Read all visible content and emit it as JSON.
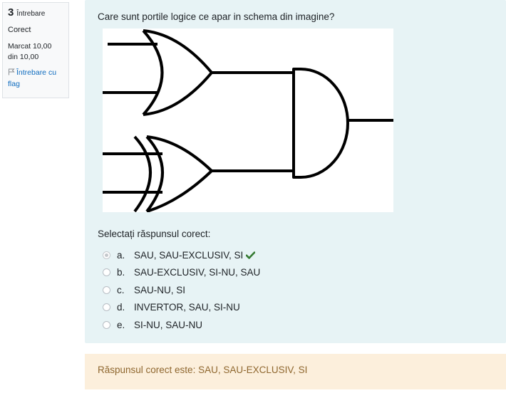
{
  "info": {
    "question_number": "3",
    "question_label": "Întrebare",
    "state": "Corect",
    "grade_line1": "Marcat 10,00",
    "grade_line2": "din 10,00",
    "flag_label": "Întrebare cu flag"
  },
  "question": {
    "text": "Care sunt portile logice ce apar in schema din imagine?",
    "prompt": "Selectați răspunsul corect:",
    "answers": [
      {
        "letter": "a.",
        "text": "SAU, SAU-EXCLUSIV, SI",
        "selected": true,
        "correct": true
      },
      {
        "letter": "b.",
        "text": "SAU-EXCLUSIV, SI-NU, SAU",
        "selected": false
      },
      {
        "letter": "c.",
        "text": "SAU-NU, SI",
        "selected": false
      },
      {
        "letter": "d.",
        "text": "INVERTOR, SAU, SI-NU",
        "selected": false
      },
      {
        "letter": "e.",
        "text": "SI-NU, SAU-NU",
        "selected": false
      }
    ]
  },
  "feedback": {
    "text": "Răspunsul corect este: SAU, SAU-EXCLUSIV, SI"
  },
  "colors": {
    "question_bg": "#e7f3f5",
    "feedback_bg": "#fcefdc",
    "feedback_text": "#8e662e",
    "link": "#0f6cbf",
    "check": "#357a32"
  }
}
